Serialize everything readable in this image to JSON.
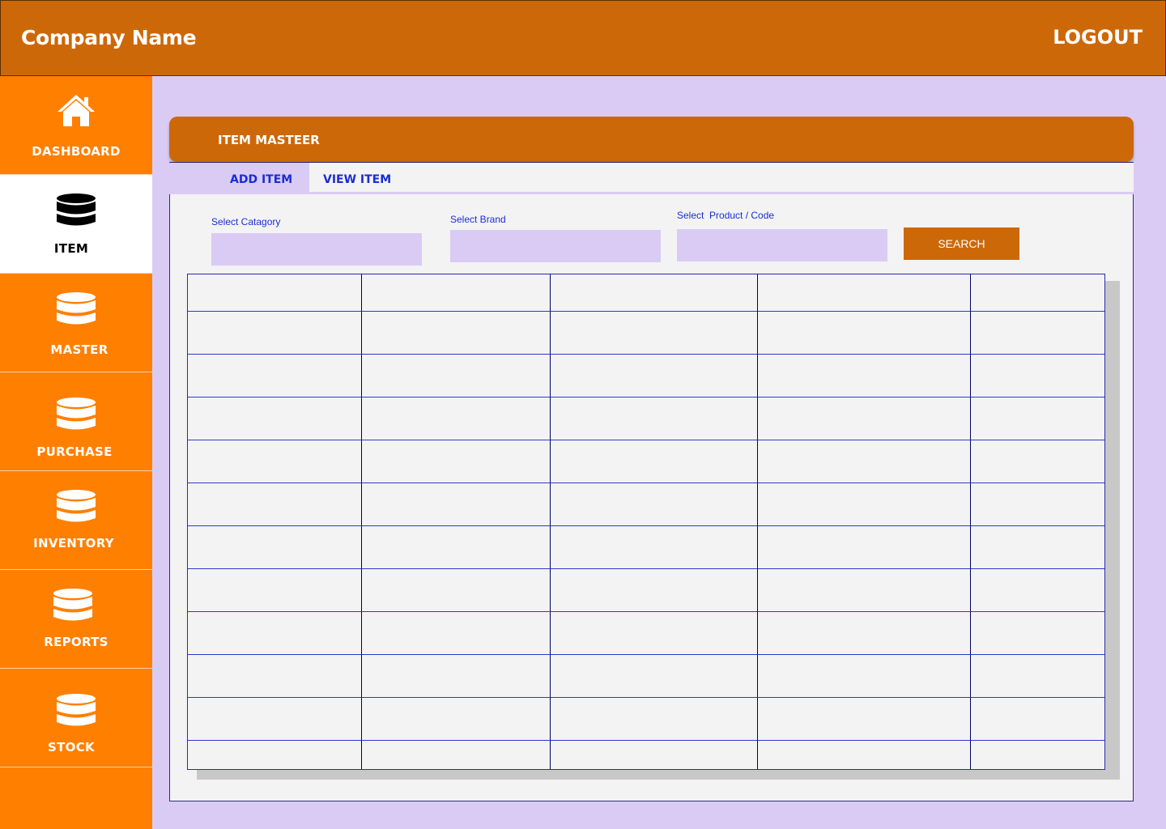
{
  "header": {
    "company_name": "Company Name",
    "logout_label": "LOGOUT"
  },
  "sidebar": {
    "items": [
      {
        "label": "DASHBOARD",
        "icon": "home-icon",
        "active": false
      },
      {
        "label": "ITEM",
        "icon": "database-icon",
        "active": true
      },
      {
        "label": "MASTER",
        "icon": "database-icon",
        "active": false
      },
      {
        "label": "PURCHASE",
        "icon": "database-icon",
        "active": false
      },
      {
        "label": "INVENTORY",
        "icon": "database-icon",
        "active": false
      },
      {
        "label": "REPORTS",
        "icon": "database-icon",
        "active": false
      },
      {
        "label": "STOCK",
        "icon": "database-icon",
        "active": false
      }
    ]
  },
  "panel": {
    "title": "ITEM MASTEER",
    "tabs": {
      "add": "ADD ITEM",
      "view": "VIEW ITEM"
    },
    "filters": {
      "category_label": "Select Catagory",
      "brand_label": "Select Brand",
      "product_label": "Select  Product / Code",
      "category_value": "",
      "brand_value": "",
      "product_value": ""
    },
    "search_label": "SEARCH"
  },
  "grid": {
    "columns": 5,
    "rows": 12
  },
  "colors": {
    "header": "#cd6809",
    "sidebar": "#ff7f00",
    "background": "#dacbf5",
    "panel": "#f3f3f3",
    "accent_text": "#1a2dd6"
  }
}
